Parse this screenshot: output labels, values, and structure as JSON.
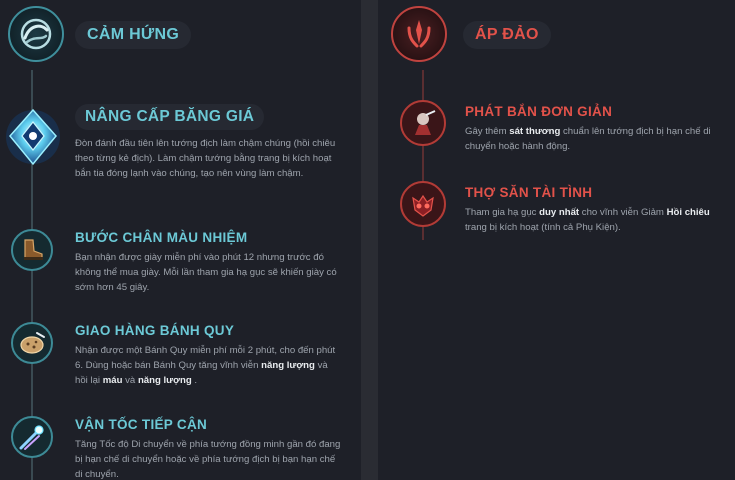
{
  "inspiration": {
    "title": "CẢM HỨNG",
    "emblem_icon": "inspiration-tree-icon",
    "keystone": {
      "name": "NÂNG CẤP BĂNG GIÁ",
      "icon": "glacial-augment-icon",
      "description": "Đòn đánh đầu tiên lên tướng địch làm chậm chúng (hồi chiêu theo từng kẻ địch). Làm chậm tướng bằng trang bị kích hoạt bắn tia đóng lạnh vào chúng, tạo nên vùng làm chậm."
    },
    "runes": [
      {
        "name": "BƯỚC CHÂN MÀU NHIỆM",
        "icon": "magical-footwear-icon",
        "description": "Bạn nhận được giày miễn phí vào phút 12 nhưng trước đó không thể mua giày. Mỗi lần tham gia hạ gục sẽ khiến giày có sớm hơn 45 giây."
      },
      {
        "name": "GIAO HÀNG BÁNH QUY",
        "icon": "biscuit-delivery-icon",
        "description_parts": [
          "Nhận được một Bánh Quy miễn phí mỗi 2 phút, cho đến phút 6. Dùng hoặc bán Bánh Quy tăng vĩnh viễn ",
          "năng lượng",
          " và hồi lại ",
          "máu",
          " và ",
          "năng lượng",
          " ."
        ]
      },
      {
        "name": "VẬN TỐC TIẾP CẬN",
        "icon": "approach-velocity-icon",
        "description": "Tăng Tốc độ Di chuyển về phía tướng đồng minh gần đó đang bị hạn chế di chuyển hoặc về phía tướng địch bị bạn hạn chế di chuyển."
      }
    ]
  },
  "domination": {
    "title": "ÁP ĐẢO",
    "emblem_icon": "domination-tree-icon",
    "runes": [
      {
        "name": "PHÁT BẮN ĐƠN GIẢN",
        "icon": "cheap-shot-icon",
        "description_parts": [
          "Gây thêm ",
          "sát thương",
          " chuẩn lên tướng địch bị hạn chế di chuyển hoặc hành động."
        ]
      },
      {
        "name": "THỢ SĂN TÀI TÌNH",
        "icon": "ingenious-hunter-icon",
        "description_parts": [
          "Tham gia hạ gục ",
          "duy nhất",
          " cho vĩnh viễn Giảm ",
          "Hồi chiêu",
          " trang bị kích hoạt (tính cả Phụ Kiện)."
        ]
      }
    ]
  },
  "colors": {
    "inspiration_accent": "#6cc9d6",
    "domination_accent": "#e2524a",
    "panel_background": "#1e2028",
    "gap_background": "#2a2c33"
  }
}
